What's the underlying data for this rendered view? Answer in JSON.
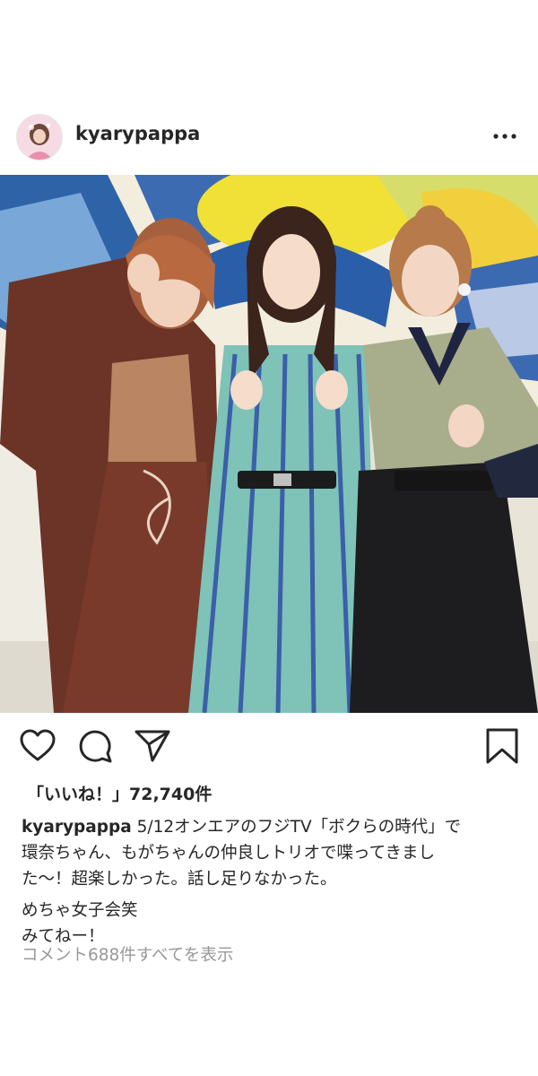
{
  "post": {
    "username": "kyarypappa",
    "avatar_icon": "profile-avatar",
    "more_icon": "ellipsis-icon"
  },
  "actions": {
    "like_icon": "heart-icon",
    "comment_icon": "comment-icon",
    "share_icon": "paper-plane-icon",
    "save_icon": "bookmark-icon"
  },
  "likes": {
    "text": "「いいね！」72,740件"
  },
  "caption": {
    "username": "kyarypappa",
    "lines": [
      "5/12オンエアのフジTV「ボクらの時代」で",
      "環奈ちゃん、もがちゃんの仲良しトリオで喋ってきまし",
      "た〜！超楽しかった。話し足りなかった。",
      "めちゃ女子会笑",
      "みてねー！"
    ]
  },
  "comments": {
    "view_all": "コメント688件すべてを表示"
  },
  "colors": {
    "text": "#262626",
    "muted": "#999999",
    "coat_brown": "#6b3427",
    "dress_teal": "#7ec2b8",
    "skirt_black": "#1d1d1f",
    "top_sage": "#a8ad8c"
  }
}
